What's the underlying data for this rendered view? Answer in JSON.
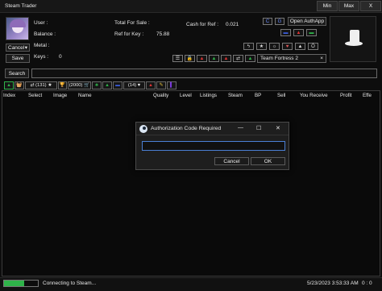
{
  "window": {
    "title": "Steam Trader",
    "min_label": "Min",
    "max_label": "Max",
    "close_label": "X"
  },
  "profile": {
    "cancel_label": "Cancel",
    "save_label": "Save",
    "user_label": "User :",
    "balance_label": "Balance :",
    "metal_label": "Metal :",
    "keys_label": "Keys :",
    "keys_value": "0",
    "total_for_sale_label": "Total For Sale :",
    "ref_for_key_label": "Ref for Key :",
    "ref_for_key_value": "75.88",
    "cash_for_ref_label": "Cash for Ref :",
    "cash_for_ref_value": "0.021"
  },
  "toolbar": {
    "open_authapp_label": "Open AuthApp",
    "game_select_value": "Team Fortress 2",
    "game_select_arrow": "×",
    "top_icons": [
      "C",
      "G"
    ],
    "status_icons": [
      {
        "name": "blue-icon",
        "color": "#3a5bd9",
        "glyph": "▬"
      },
      {
        "name": "red-icon",
        "color": "#d33",
        "glyph": "▲"
      },
      {
        "name": "green-icon",
        "color": "#2fb34a",
        "glyph": "▬"
      }
    ],
    "row_icons": [
      "ϟ",
      "★",
      "☼",
      "♥",
      "▲",
      "Ô"
    ],
    "bottom_icons": [
      "☰",
      "🔒",
      "▲",
      "▲",
      "▲",
      "⇄",
      "▲"
    ]
  },
  "search": {
    "button_label": "Search",
    "value": ""
  },
  "tabs": [
    {
      "label": "▲",
      "color": "#2fb34a"
    },
    {
      "label": "🧺",
      "color": "#e07b39"
    },
    {
      "label": "⇄ (131) ★",
      "color": "#eee"
    },
    {
      "label": "🏆",
      "color": "#e8c13a"
    },
    {
      "label": "(2000) 🛒",
      "color": "#eee"
    },
    {
      "label": "♣",
      "color": "#2fb34a"
    },
    {
      "label": "▲",
      "color": "#2fb34a"
    },
    {
      "label": "▬",
      "color": "#3a5bd9"
    },
    {
      "label": "(14) ♥",
      "color": "#eee"
    },
    {
      "label": "▲",
      "color": "#d33"
    },
    {
      "label": "✎",
      "color": "#e8c13a"
    },
    {
      "label": "▌",
      "color": "#7a3ad9"
    }
  ],
  "table": {
    "columns": [
      "Index",
      "Select",
      "Image",
      "Name",
      "Quality",
      "Level",
      "Listings",
      "Steam",
      "BP",
      "Sell",
      "You Receive",
      "Profit",
      "Effe"
    ]
  },
  "dialog": {
    "title": "Authorization Code Required",
    "input_value": "",
    "cancel_label": "Cancel",
    "ok_label": "OK",
    "minimize_glyph": "—",
    "maximize_glyph": "☐",
    "close_glyph": "✕"
  },
  "status": {
    "text": "Connecting to Steam...",
    "progress": 0.6,
    "timestamp": "5/23/2023 3:53:33 AM",
    "coords": "0 : 0"
  }
}
